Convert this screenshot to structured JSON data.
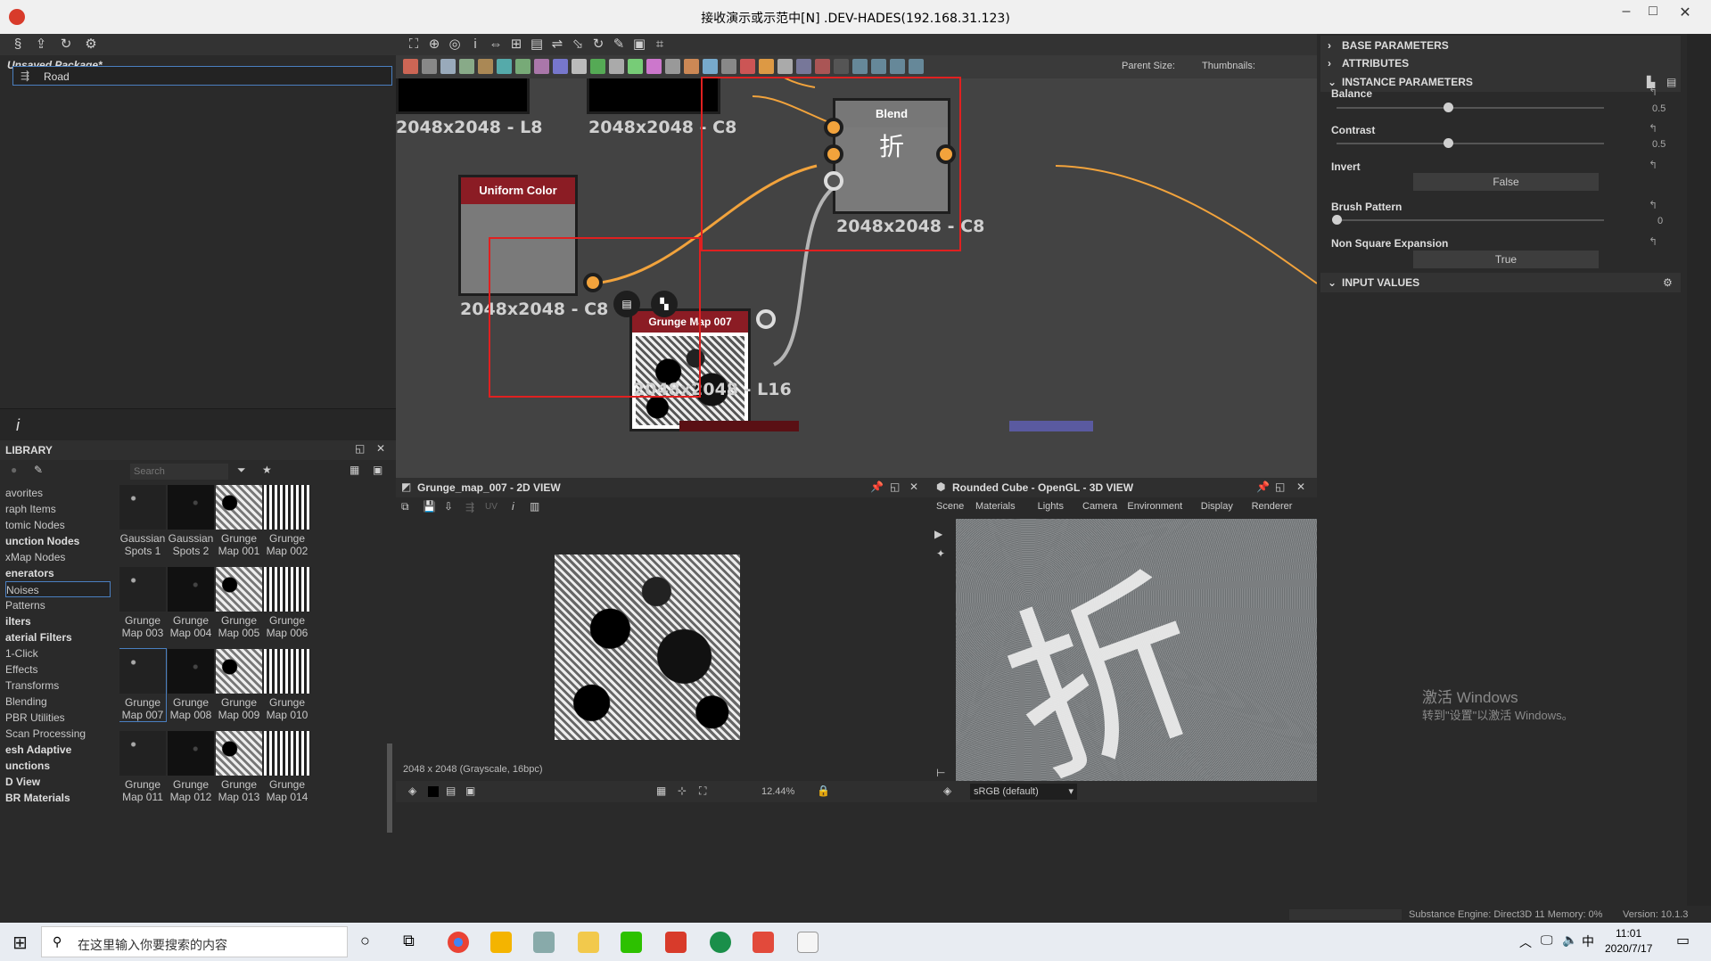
{
  "window": {
    "title": "接收演示或示范中[N] .DEV-HADES(192.168.31.123)",
    "minimize": "–",
    "maximize": "□",
    "close": "✕"
  },
  "explorer": {
    "package": "Unsaved Package*",
    "graph_item": "Road",
    "info_glyph": "i"
  },
  "library": {
    "title": "LIBRARY",
    "search_placeholder": "Search",
    "categories": [
      {
        "label": "avorites",
        "bold": false
      },
      {
        "label": "raph Items",
        "bold": false
      },
      {
        "label": "tomic Nodes",
        "bold": false
      },
      {
        "label": "unction Nodes",
        "bold": true
      },
      {
        "label": "xMap Nodes",
        "bold": false
      },
      {
        "label": "enerators",
        "bold": true
      },
      {
        "label": "Noises",
        "bold": false
      },
      {
        "label": "Patterns",
        "bold": false
      },
      {
        "label": "ilters",
        "bold": true
      },
      {
        "label": "aterial Filters",
        "bold": true
      },
      {
        "label": "1-Click",
        "bold": false
      },
      {
        "label": "Effects",
        "bold": false
      },
      {
        "label": "Transforms",
        "bold": false
      },
      {
        "label": "Blending",
        "bold": false
      },
      {
        "label": "PBR Utilities",
        "bold": false
      },
      {
        "label": "Scan Processing",
        "bold": false
      },
      {
        "label": "esh Adaptive",
        "bold": true
      },
      {
        "label": "unctions",
        "bold": true
      },
      {
        "label": "D View",
        "bold": true
      },
      {
        "label": "BR Materials",
        "bold": true
      }
    ],
    "items": [
      {
        "line1": "Gaussian",
        "line2": "Spots 1"
      },
      {
        "line1": "Gaussian",
        "line2": "Spots 2"
      },
      {
        "line1": "Grunge",
        "line2": "Map 001"
      },
      {
        "line1": "Grunge",
        "line2": "Map 002"
      },
      {
        "line1": "Grunge",
        "line2": "Map 003"
      },
      {
        "line1": "Grunge",
        "line2": "Map 004"
      },
      {
        "line1": "Grunge",
        "line2": "Map 005"
      },
      {
        "line1": "Grunge",
        "line2": "Map 006"
      },
      {
        "line1": "Grunge",
        "line2": "Map 007"
      },
      {
        "line1": "Grunge",
        "line2": "Map 008"
      },
      {
        "line1": "Grunge",
        "line2": "Map 009"
      },
      {
        "line1": "Grunge",
        "line2": "Map 010"
      },
      {
        "line1": "Grunge",
        "line2": "Map 011"
      },
      {
        "line1": "Grunge",
        "line2": "Map 012"
      },
      {
        "line1": "Grunge",
        "line2": "Map 013"
      },
      {
        "line1": "Grunge",
        "line2": "Map 014"
      }
    ]
  },
  "graph": {
    "parent_size_label": "Parent Size:",
    "thumbnails_label": "Thumbnails:",
    "nodes": {
      "top_left_label": "2048x2048 - L8",
      "top_mid_label": "2048x2048 - C8",
      "uniform_color_title": "Uniform Color",
      "uniform_color_label": "2048x2048 - C8",
      "grunge_title": "Grunge Map 007",
      "grunge_label": "2048x2048 - L16",
      "blend_title": "Blend",
      "blend_glyph": "折",
      "blend_label": "2048x2048 - C8"
    }
  },
  "view2d": {
    "title": "Grunge_map_007 - 2D VIEW",
    "uv_label": "UV",
    "info": "2048 x 2048 (Grayscale, 16bpc)",
    "zoom": "12.44%"
  },
  "view3d": {
    "title": "Rounded Cube - OpenGL - 3D VIEW",
    "menu": [
      "Scene",
      "Materials",
      "Lights",
      "Camera",
      "Environment",
      "Display",
      "Renderer"
    ],
    "colorspace": "sRGB (default)",
    "glyph": "折"
  },
  "properties": {
    "base_parameters": "BASE PARAMETERS",
    "attributes": "ATTRIBUTES",
    "instance_parameters": "INSTANCE PARAMETERS",
    "balance_label": "Balance",
    "balance_value": "0.5",
    "contrast_label": "Contrast",
    "contrast_value": "0.5",
    "invert_label": "Invert",
    "invert_value": "False",
    "brush_label": "Brush Pattern",
    "brush_value": "0",
    "nse_label": "Non Square Expansion",
    "nse_value": "True",
    "input_values": "INPUT VALUES",
    "slider_values": {
      "balance": 0.5,
      "contrast": 0.5,
      "brush": 0.0
    }
  },
  "watermark": {
    "line1": "激活 Windows",
    "line2": "转到\"设置\"以激活 Windows。"
  },
  "statusbar": {
    "engine": "Substance Engine: Direct3D 11  Memory: 0%",
    "version": "Version: 10.1.3"
  },
  "taskbar": {
    "search_placeholder": "在这里输入你要搜索的内容",
    "ime": "中",
    "time": "11:01",
    "date": "2020/7/17"
  },
  "colors": {
    "accent_orange": "#f2a33c",
    "node_header_red": "#8b1c24",
    "highlight_red": "#e02020"
  }
}
